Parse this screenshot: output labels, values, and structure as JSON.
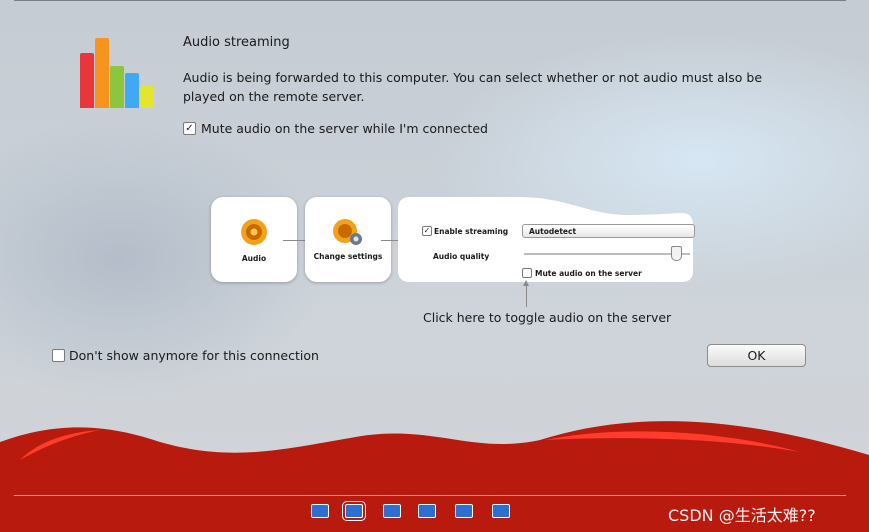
{
  "dialog": {
    "title": "Audio streaming",
    "description": "Audio is being forwarded to this computer. You can select whether or not audio must also be played on the remote server.",
    "mute_label": "Mute audio on the server while I'm connected",
    "mute_checked": true,
    "dont_show_label": "Don't show anymore for this connection",
    "dont_show_checked": false,
    "ok_label": "OK"
  },
  "illustration": {
    "step1_label": "Audio",
    "step2_label": "Change settings",
    "enable_streaming_label": "Enable streaming",
    "dropdown_value": "Autodetect",
    "audio_quality_label": "Audio quality",
    "mute_label": "Mute audio on the server",
    "hint": "Click here to toggle audio on the server"
  },
  "logo_colors": [
    "#e8363b",
    "#f7941d",
    "#8cc63f",
    "#3fa9f5",
    "#e5e52d"
  ],
  "toolbar": {
    "icons": [
      "window-icon",
      "fit-screen-icon",
      "keyboard-icon",
      "fullscreen-icon",
      "minimize-icon",
      "settings-icon"
    ]
  },
  "watermark": "CSDN @生活太难??"
}
